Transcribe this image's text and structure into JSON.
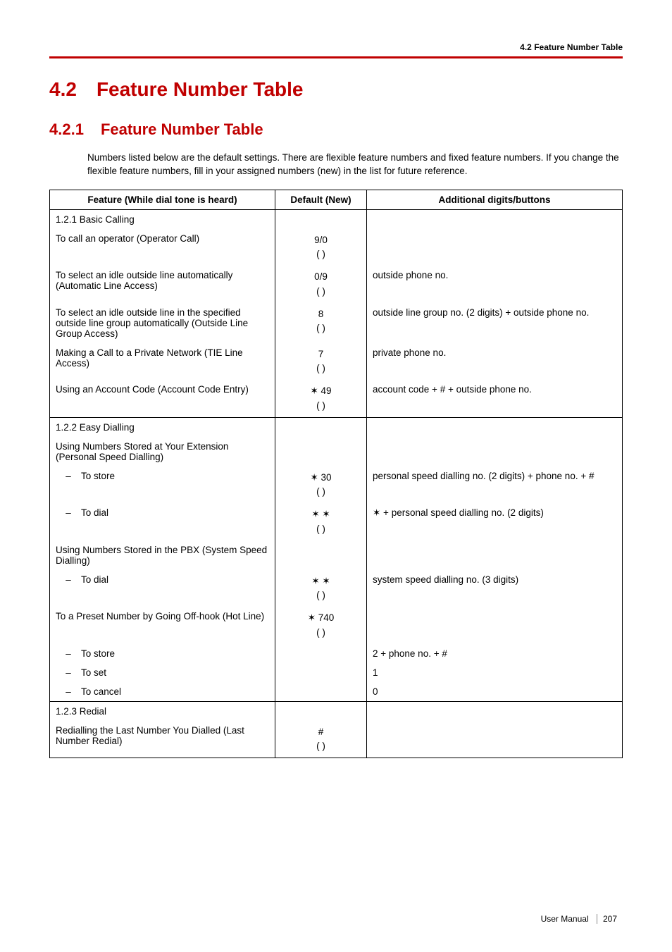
{
  "header": {
    "running": "4.2 Feature Number Table"
  },
  "title": {
    "num": "4.2",
    "text": "Feature Number Table"
  },
  "subtitle": {
    "num": "4.2.1",
    "text": "Feature Number Table"
  },
  "intro": "Numbers listed below are the default settings. There are flexible feature numbers and fixed feature numbers. If you change the flexible feature numbers, fill in your assigned numbers (new) in the list for future reference.",
  "columns": {
    "feature": "Feature (While dial tone is heard)",
    "default": "Default (New)",
    "additional": "Additional digits/buttons"
  },
  "groups": [
    {
      "heading": "1.2.1 Basic Calling",
      "rows": [
        {
          "feature": "To call an operator (Operator Call)",
          "default": "9/0",
          "paren": "(          )",
          "additional": ""
        },
        {
          "feature": "To select an idle outside line automatically (Automatic Line Access)",
          "default": "0/9",
          "paren": "(          )",
          "additional": "outside phone no."
        },
        {
          "feature": "To select an idle outside line in the specified outside line group automatically (Outside Line Group Access)",
          "default": "8",
          "paren": "(          )",
          "additional": "outside line group no. (2 digits) + outside phone no."
        },
        {
          "feature": "Making a Call to a Private Network (TIE Line Access)",
          "default": "7",
          "paren": "(          )",
          "additional": "private phone no."
        },
        {
          "feature": "Using an Account Code (Account Code Entry)",
          "default": "✶ 49",
          "paren": "(          )",
          "additional": "account code + # + outside phone no."
        }
      ]
    },
    {
      "heading": "1.2.2 Easy Dialling",
      "rows": [
        {
          "feature": "Using Numbers Stored at Your Extension (Personal Speed Dialling)",
          "default": "",
          "paren": "",
          "additional": ""
        },
        {
          "indent": true,
          "feature": "To store",
          "default": "✶ 30",
          "paren": "(          )",
          "additional": "personal speed dialling no. (2 digits) + phone no. + #"
        },
        {
          "indent": true,
          "feature": "To dial",
          "default": "✶ ✶",
          "paren": "(          )",
          "additional": "✶ + personal speed dialling no. (2 digits)"
        },
        {
          "feature": "Using Numbers Stored in the PBX (System Speed Dialling)",
          "default": "",
          "paren": "",
          "additional": ""
        },
        {
          "indent": true,
          "feature": "To dial",
          "default": "✶ ✶",
          "paren": "(          )",
          "additional": "system speed dialling no. (3 digits)"
        },
        {
          "feature": "To a Preset Number by Going Off-hook (Hot Line)",
          "default": "✶ 740",
          "paren": "(          )",
          "additional": ""
        },
        {
          "indent": true,
          "feature": "To store",
          "default": "",
          "paren": "",
          "additional": "2 + phone no. + #"
        },
        {
          "indent": true,
          "feature": "To set",
          "default": "",
          "paren": "",
          "additional": "1"
        },
        {
          "indent": true,
          "feature": "To cancel",
          "default": "",
          "paren": "",
          "additional": "0"
        }
      ]
    },
    {
      "heading": "1.2.3 Redial",
      "rows": [
        {
          "feature": "Redialling the Last Number You Dialled (Last Number Redial)",
          "default": "#",
          "paren": "(          )",
          "additional": ""
        }
      ]
    }
  ],
  "footer": {
    "label": "User Manual",
    "page": "207"
  }
}
